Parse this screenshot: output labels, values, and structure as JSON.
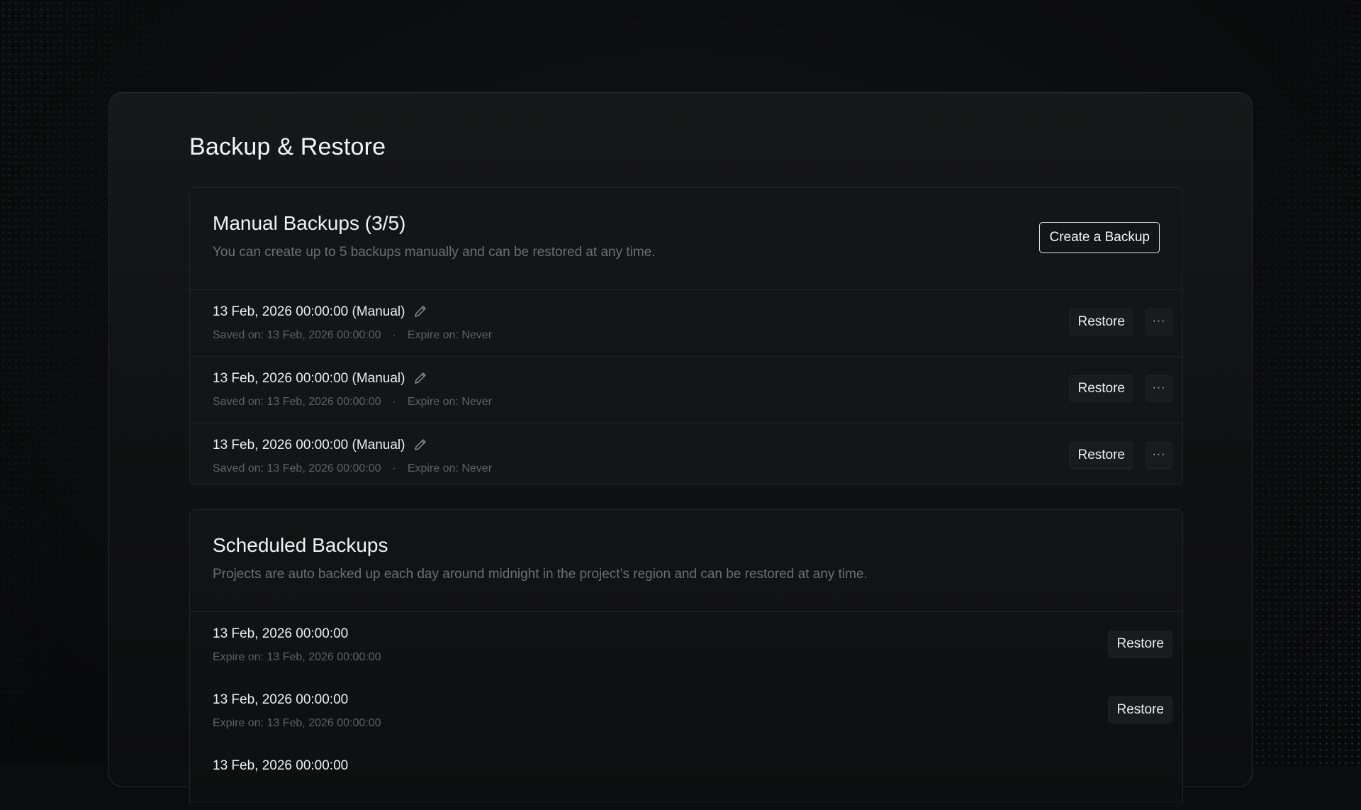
{
  "page": {
    "title": "Backup & Restore"
  },
  "manual": {
    "title": "Manual Backups (3/5)",
    "description": "You can create up to 5 backups manually and can be restored at any time.",
    "create_label": "Create a Backup",
    "items": [
      {
        "title": "13 Feb, 2026 00:00:00 (Manual)",
        "saved": "Saved on: 13 Feb, 2026 00:00:00",
        "separator": "·",
        "expire": "Expire on: Never",
        "restore_label": "Restore",
        "more_label": "···"
      },
      {
        "title": "13 Feb, 2026 00:00:00 (Manual)",
        "saved": "Saved on: 13 Feb, 2026 00:00:00",
        "separator": "·",
        "expire": "Expire on: Never",
        "restore_label": "Restore",
        "more_label": "···"
      },
      {
        "title": "13 Feb, 2026 00:00:00 (Manual)",
        "saved": "Saved on: 13 Feb, 2026 00:00:00",
        "separator": "·",
        "expire": "Expire on: Never",
        "restore_label": "Restore",
        "more_label": "···"
      }
    ]
  },
  "scheduled": {
    "title": "Scheduled Backups",
    "description": "Projects are auto backed up each day around midnight in the project’s region and can be restored at any time.",
    "items": [
      {
        "title": "13 Feb, 2026 00:00:00",
        "expire": "Expire on: 13 Feb, 2026 00:00:00",
        "restore_label": "Restore"
      },
      {
        "title": "13 Feb, 2026 00:00:00",
        "expire": "Expire on: 13 Feb, 2026 00:00:00",
        "restore_label": "Restore"
      },
      {
        "title": "13 Feb, 2026 00:00:00",
        "expire": "",
        "restore_label": ""
      }
    ]
  },
  "icons": {
    "edit": "pencil-icon",
    "more": "more-horizontal-icon"
  },
  "colors": {
    "background": "#0b0c0d",
    "panel": "#141516",
    "border": "#232426",
    "text_primary": "#f2f2f2",
    "text_muted": "#6d6e71"
  }
}
